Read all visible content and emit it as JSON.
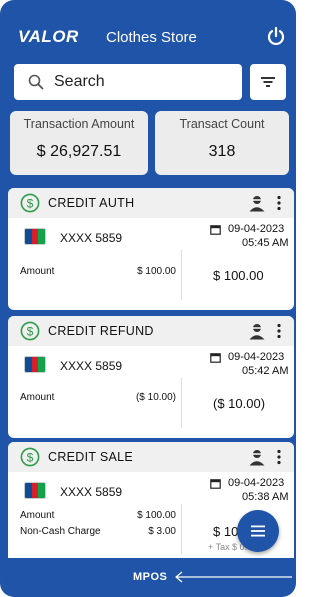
{
  "header": {
    "logo": "VALOR",
    "store_name": "Clothes Store",
    "power_icon": "power-icon"
  },
  "search": {
    "label": "Search",
    "icon": "search-icon",
    "filter_icon": "filter-icon"
  },
  "summary": {
    "transaction_amount_label": "Transaction Amount",
    "transaction_amount_value": "$ 26,927.51",
    "transact_count_label": "Transact Count",
    "transact_count_value": "318"
  },
  "transactions": [
    {
      "type": "CREDIT AUTH",
      "card": "XXXX 5859",
      "date": "09-04-2023",
      "time": "05:45 AM",
      "amount_label": "Amount",
      "amount_value": "$ 100.00",
      "total": "$ 100.00"
    },
    {
      "type": "CREDIT REFUND",
      "card": "XXXX 5859",
      "date": "09-04-2023",
      "time": "05:42 AM",
      "amount_label": "Amount",
      "amount_value": "($ 10.00)",
      "total": "($ 10.00)"
    },
    {
      "type": "CREDIT SALE",
      "card": "XXXX 5859",
      "date": "09-04-2023",
      "time": "05:38 AM",
      "amount_label": "Amount",
      "amount_value": "$ 100.00",
      "noncash_label": "Non-Cash Charge",
      "noncash_value": "$ 3.00",
      "total": "$ 10",
      "tax_note": "+ Tax $ 0.00"
    }
  ],
  "footer": {
    "label": "MPOS"
  },
  "colors": {
    "primary": "#1f54a8",
    "success": "#2e9c4a",
    "card_header": "#f0f0f0"
  }
}
